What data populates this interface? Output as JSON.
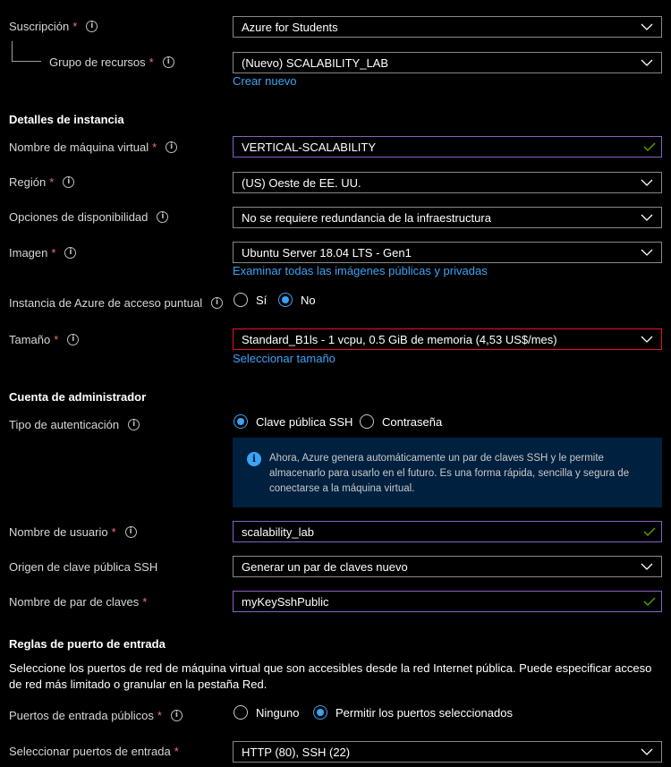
{
  "basics": {
    "subscription": {
      "label": "Suscripción",
      "value": "Azure for Students"
    },
    "resource_group": {
      "label": "Grupo de recursos",
      "value": "(Nuevo) SCALABILITY_LAB",
      "link": "Crear nuevo"
    }
  },
  "instance_details": {
    "heading": "Detalles de instancia",
    "vm_name": {
      "label": "Nombre de máquina virtual",
      "value": "VERTICAL-SCALABILITY"
    },
    "region": {
      "label": "Región",
      "value": "(US) Oeste de EE. UU."
    },
    "availability": {
      "label": "Opciones de disponibilidad",
      "value": "No se requiere redundancia de la infraestructura"
    },
    "image": {
      "label": "Imagen",
      "value": "Ubuntu Server 18.04 LTS - Gen1",
      "link": "Examinar todas las imágenes públicas y privadas"
    },
    "spot": {
      "label": "Instancia de Azure de acceso puntual",
      "options": [
        "Sí",
        "No"
      ],
      "selected": "No"
    },
    "size": {
      "label": "Tamaño",
      "value": "Standard_B1ls - 1 vcpu, 0.5 GiB de memoria (4,53 US$/mes)",
      "link": "Seleccionar tamaño"
    }
  },
  "admin": {
    "heading": "Cuenta de administrador",
    "auth_type": {
      "label": "Tipo de autenticación",
      "options": [
        "Clave pública SSH",
        "Contraseña"
      ],
      "selected": "Clave pública SSH"
    },
    "info": "Ahora, Azure genera automáticamente un par de claves SSH y le permite almacenarlo para usarlo en el futuro. Es una forma rápida, sencilla y segura de conectarse a la máquina virtual.",
    "username": {
      "label": "Nombre de usuario",
      "value": "scalability_lab"
    },
    "ssh_source": {
      "label": "Origen de clave pública SSH",
      "value": "Generar un par de claves nuevo"
    },
    "key_name": {
      "label": "Nombre de par de claves",
      "value": "myKeySshPublic"
    }
  },
  "inbound": {
    "heading": "Reglas de puerto de entrada",
    "description": "Seleccione los puertos de red de máquina virtual que son accesibles desde la red Internet pública. Puede especificar acceso de red más limitado o granular en la pestaña Red.",
    "public_ports": {
      "label": "Puertos de entrada públicos",
      "options": [
        "Ninguno",
        "Permitir los puertos seleccionados"
      ],
      "selected": "Permitir los puertos seleccionados"
    },
    "select_ports": {
      "label": "Seleccionar puertos de entrada",
      "value": "HTTP (80), SSH (22)"
    }
  },
  "icons": {
    "info": "info-icon",
    "chevron": "chevron-down-icon",
    "check": "checkmark-icon"
  },
  "colors": {
    "link": "#3ca2f6",
    "required": "#f1707b",
    "error_border": "#e81123",
    "valid_border": "#8661c5",
    "valid_check": "#57a300",
    "info_bg": "#00203f"
  }
}
